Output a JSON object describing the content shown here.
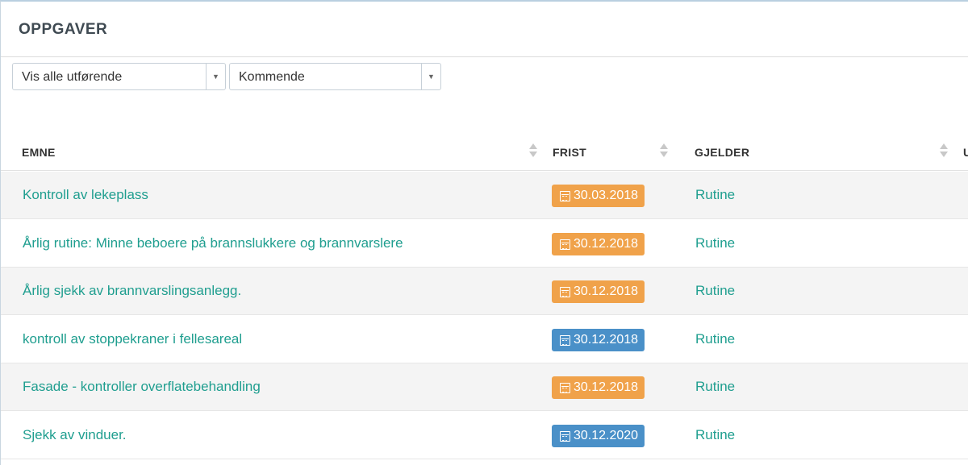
{
  "panel": {
    "title": "OPPGAVER"
  },
  "filters": {
    "performer": {
      "value": "Vis alle utførende"
    },
    "period": {
      "value": "Kommende"
    }
  },
  "table": {
    "columns": [
      "EMNE",
      "FRIST",
      "GJELDER",
      "U"
    ],
    "rows": [
      {
        "emne": "Kontroll av lekeplass",
        "frist": "30.03.2018",
        "frist_status": "warning",
        "gjelder": "Rutine"
      },
      {
        "emne": "Årlig rutine: Minne beboere på brannslukkere og brannvarslere",
        "frist": "30.12.2018",
        "frist_status": "warning",
        "gjelder": "Rutine"
      },
      {
        "emne": "Årlig sjekk av brannvarslingsanlegg.",
        "frist": "30.12.2018",
        "frist_status": "warning",
        "gjelder": "Rutine"
      },
      {
        "emne": "kontroll av stoppekraner i fellesareal",
        "frist": "30.12.2018",
        "frist_status": "info",
        "gjelder": "Rutine"
      },
      {
        "emne": "Fasade - kontroller overflatebehandling",
        "frist": "30.12.2018",
        "frist_status": "warning",
        "gjelder": "Rutine"
      },
      {
        "emne": "Sjekk av vinduer.",
        "frist": "30.12.2020",
        "frist_status": "info",
        "gjelder": "Rutine"
      }
    ]
  },
  "colors": {
    "link": "#1f9e8f",
    "badge_warning": "#f0a24a",
    "badge_info": "#4a90c8"
  },
  "icons": {
    "deadline": "calendar-icon",
    "dropdown": "caret-down-icon",
    "sort": "sort-icon"
  }
}
